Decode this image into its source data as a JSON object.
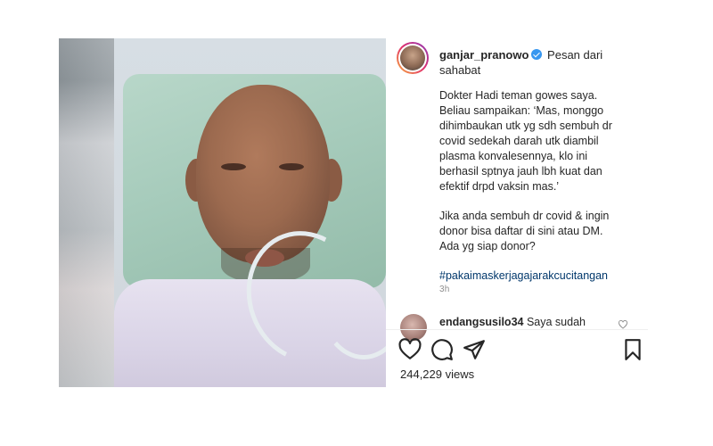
{
  "post": {
    "author": {
      "username": "ganjar_pranowo",
      "verified": true,
      "title_text": "Pesan dari sahabat"
    },
    "caption": {
      "paragraph_1": "Dokter Hadi teman gowes saya. Beliau sampaikan: ‘Mas, monggo dihimbaukan utk yg sdh sembuh dr covid sedekah darah utk diambil plasma konvalesennya, klo ini berhasil sptnya jauh lbh kuat dan efektif drpd vaksin mas.’",
      "paragraph_2": "Jika anda sembuh dr covid & ingin donor bisa daftar di sini atau DM. Ada yg siap donor?",
      "hashtag": "#pakaimaskerjagajarakcucitangan"
    },
    "timestamp": "3h",
    "comment": {
      "username": "endangsusilo34",
      "text": "Saya sudah"
    },
    "actions": {
      "like_icon": "heart-outline-icon",
      "comment_icon": "comment-bubble-icon",
      "share_icon": "paper-plane-icon",
      "save_icon": "bookmark-icon"
    },
    "views": "244,229 views"
  },
  "colors": {
    "verified": "#3897f0",
    "hashtag": "#00376b",
    "muted": "#8e8e8e",
    "text": "#262626"
  }
}
